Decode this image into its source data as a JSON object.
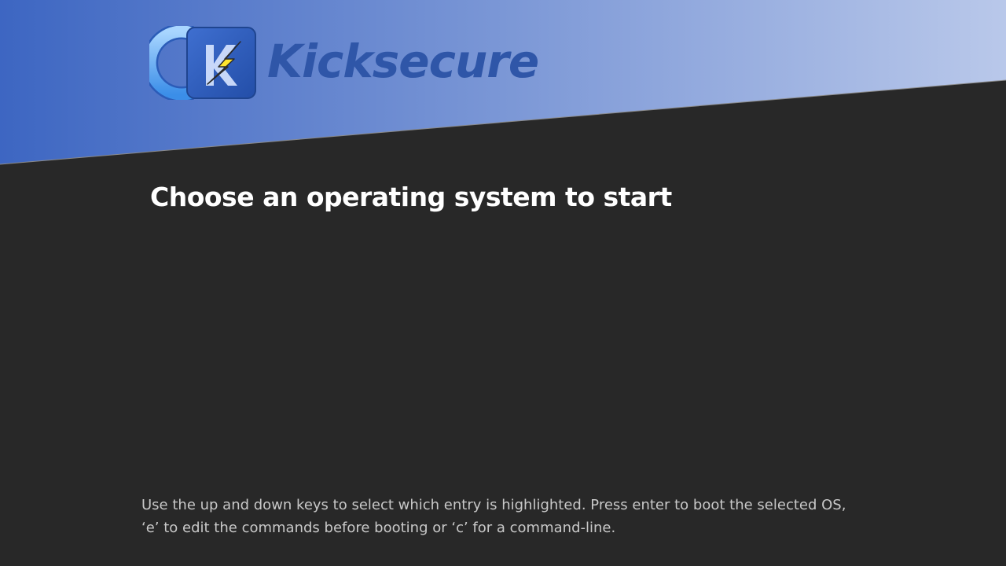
{
  "branding": {
    "name": "Kicksecure",
    "logo_icon": "kicksecure-shield-icon",
    "banner_gradient": [
      "#3d66c2",
      "#b9c8ea"
    ]
  },
  "menu": {
    "title": "Choose an operating system to start",
    "entries": []
  },
  "help": {
    "line1": "Use the up and down keys to select which entry is highlighted. Press enter to boot the selected OS,",
    "line2": "‘e’ to edit the commands before booting or ‘c’ for a command-line."
  },
  "colors": {
    "background": "#282828",
    "title": "#ffffff",
    "help_text": "#c8c8c8",
    "logo_text": "#2f56a8"
  }
}
